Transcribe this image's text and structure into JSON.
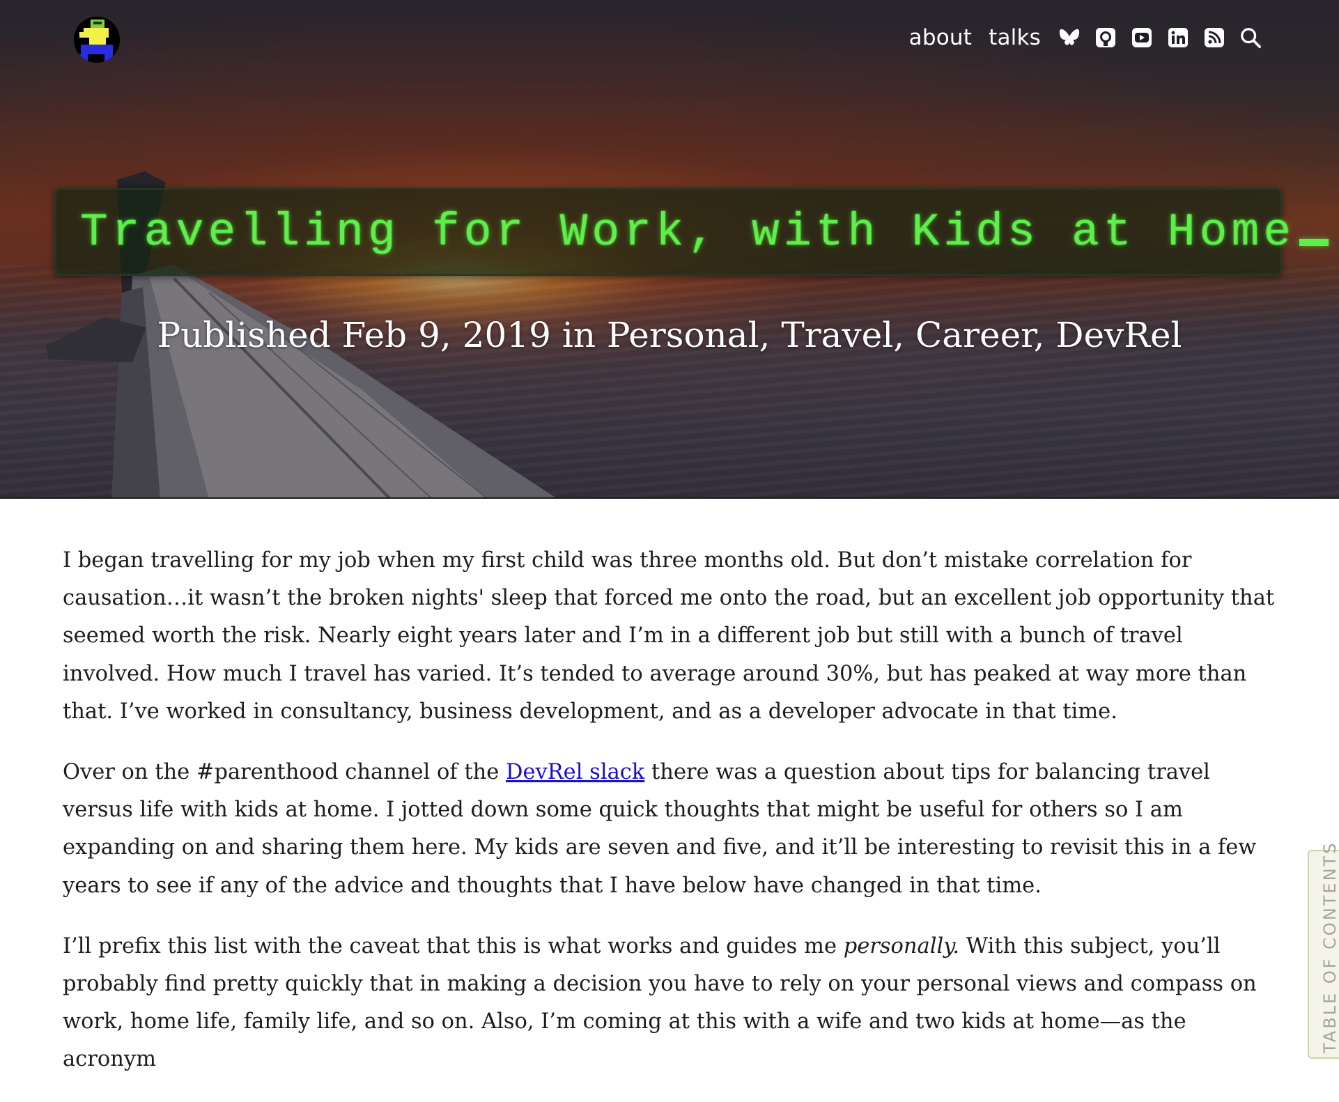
{
  "nav": {
    "about": "about",
    "talks": "talks",
    "icons": [
      "bluesky-icon",
      "github-icon",
      "youtube-icon",
      "linkedin-icon",
      "rss-icon",
      "search-icon"
    ]
  },
  "post": {
    "title": "Travelling for Work, with Kids at Home",
    "subtitle": "Published Feb 9, 2019 in Personal, Travel, Career, DevRel"
  },
  "article": {
    "p1": "I began travelling for my job when my first child was three months old. But don’t mistake correlation for causation…it wasn’t the broken nights' sleep that forced me onto the road, but an excellent job opportunity that seemed worth the risk. Nearly eight years later and I’m in a different job but still with a bunch of travel involved. How much I travel has varied. It’s tended to average around 30%, but has peaked at way more than that. I’ve worked in consultancy, business development, and as a developer advocate in that time.",
    "p2_before": "Over on the #parenthood channel of the ",
    "p2_link": "DevRel slack",
    "p2_after": " there was a question about tips for balancing travel versus life with kids at home. I jotted down some quick thoughts that might be useful for others so I am expanding on and sharing them here. My kids are seven and five, and it’ll be interesting to revisit this in a few years to see if any of the advice and thoughts that I have below have changed in that time.",
    "p3_before": "I’ll prefix this list with the caveat that this is what works and guides me ",
    "p3_em": "personally.",
    "p3_after": " With this subject, you’ll probably find pretty quickly that in making a decision you have to rely on your personal views and compass on work, home life, family life, and so on. Also, I’m coming at this with a wife and two kids at home—as the acronym"
  },
  "toc": {
    "label": "TABLE OF CONTENTS"
  },
  "colors": {
    "title_green": "#5df04a",
    "link_blue": "#1a0dcc"
  }
}
